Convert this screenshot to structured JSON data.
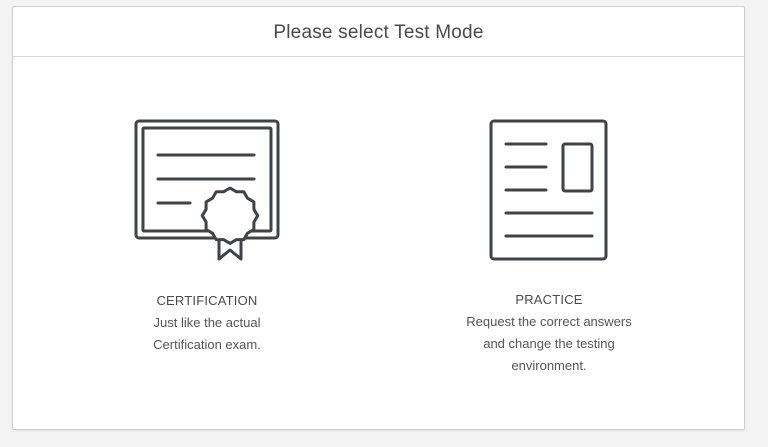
{
  "dialog": {
    "title": "Please select Test Mode"
  },
  "modes": [
    {
      "label": "CERTIFICATION",
      "description": "Just like the actual\nCertification exam.",
      "icon": "certificate-icon"
    },
    {
      "label": "PRACTICE",
      "description": "Request the correct answers\nand change the testing\nenvironment.",
      "icon": "document-icon"
    }
  ],
  "colors": {
    "icon_stroke": "#3f4347",
    "text": "#4a4a4a",
    "background": "#f3f3f3",
    "panel": "#ffffff",
    "border": "#cfcfcf"
  }
}
